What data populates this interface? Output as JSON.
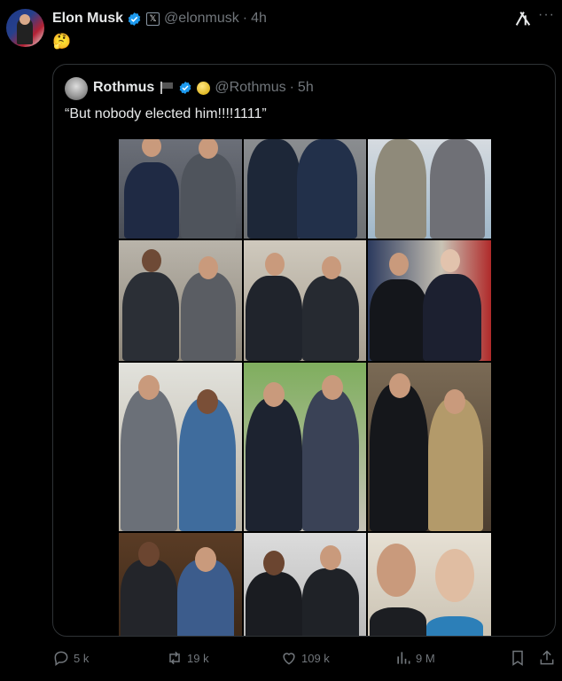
{
  "post": {
    "author_name": "Elon Musk",
    "handle": "@elonmusk",
    "separator": "·",
    "time": "4h",
    "text": "🤔"
  },
  "quoted_post": {
    "author_name": "Rothmus",
    "handle": "@Rothmus",
    "separator": "·",
    "time": "5h",
    "text": "“But nobody elected him!!!!1111”"
  },
  "actions": {
    "replies": "5 k",
    "reposts": "19 k",
    "likes": "109 k",
    "views": "9 M"
  },
  "colors": {
    "background": "#000000",
    "text": "#e7e9ea",
    "muted": "#71767b",
    "verified": "#1d9bf0",
    "border": "#2f3336"
  },
  "icons": [
    "verified-badge-icon",
    "x-logo-icon",
    "grok-icon",
    "more-icon",
    "reply-icon",
    "repost-icon",
    "like-icon",
    "views-icon",
    "bookmark-icon",
    "share-icon"
  ]
}
